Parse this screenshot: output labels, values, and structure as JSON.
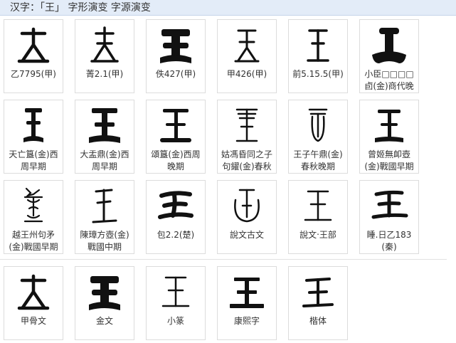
{
  "header": {
    "title": "汉字：「王」 字形演变 字源演变"
  },
  "evolution": [
    {
      "label": "乙7795(甲)"
    },
    {
      "label": "菁2.1(甲)"
    },
    {
      "label": "佚427(甲)"
    },
    {
      "label": "甲426(甲)"
    },
    {
      "label": "前5.15.5(甲)"
    },
    {
      "label": "小臣□□□□卣(金)商代晚期"
    },
    {
      "label": "天亡簋(金)西周早期"
    },
    {
      "label": "大盂鼎(金)西周早期"
    },
    {
      "label": "頌簋(金)西周晚期"
    },
    {
      "label": "姑馮昏同之子句鑃(金)春秋"
    },
    {
      "label": "王子午鼎(金)春秋晚期"
    },
    {
      "label": "曾姬無卹壺(金)戰國早期"
    },
    {
      "label": "越王州句矛(金)戰國早期"
    },
    {
      "label": "陳璋方壺(金)戰國中期"
    },
    {
      "label": "包2.2(楚)"
    },
    {
      "label": "說文古文"
    },
    {
      "label": "說文‧王部"
    },
    {
      "label": "睡.日乙183(秦)"
    }
  ],
  "styles": [
    {
      "label": "甲骨文"
    },
    {
      "label": "金文"
    },
    {
      "label": "小篆"
    },
    {
      "label": "康熙字"
    },
    {
      "label": "楷体"
    }
  ]
}
